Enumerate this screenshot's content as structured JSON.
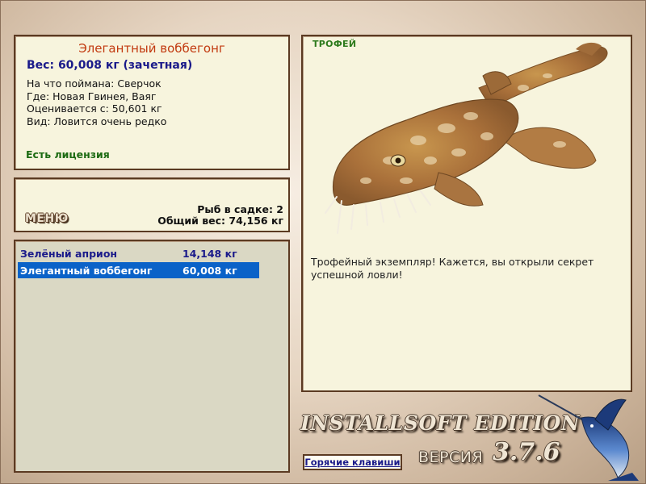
{
  "fish_info": {
    "name": "Элегантный воббегонг",
    "weight": "Вес: 60,008 кг (зачетная)",
    "lines": [
      "На что поймана: Сверчок",
      "Где: Новая Гвинея, Ваяг",
      "Оценивается с: 50,601 кг",
      "Вид: Ловится очень редко"
    ],
    "license": "Есть лицензия"
  },
  "summary": {
    "menu_label": "МЕНЮ",
    "fish_count": "Рыб в садке: 2",
    "total_weight": "Общий вес: 74,156 кг"
  },
  "catch_list": [
    {
      "name": "Зелёный априон",
      "weight": "14,148 кг",
      "selected": false
    },
    {
      "name": "Элегантный воббегонг",
      "weight": "60,008 кг",
      "selected": true
    }
  ],
  "trophy": {
    "label": "ТРОФЕЙ",
    "message": "Трофейный экземпляр! Кажется, вы открыли секрет успешной ловли!"
  },
  "branding": {
    "edition": "INSTALLSOFT EDITION",
    "version_label": "ВЕРСИЯ",
    "version_number": "3.7.6"
  },
  "hotkeys_label": "Горячие клавиши",
  "colors": {
    "panel_bg": "#f7f4dd",
    "panel_border": "#5b3a22",
    "fish_name": "#c23a10",
    "weight_text": "#1a1a8a",
    "license_text": "#1c6a12",
    "selected_row": "#0a62c8",
    "list_bg": "#dad8c4"
  }
}
